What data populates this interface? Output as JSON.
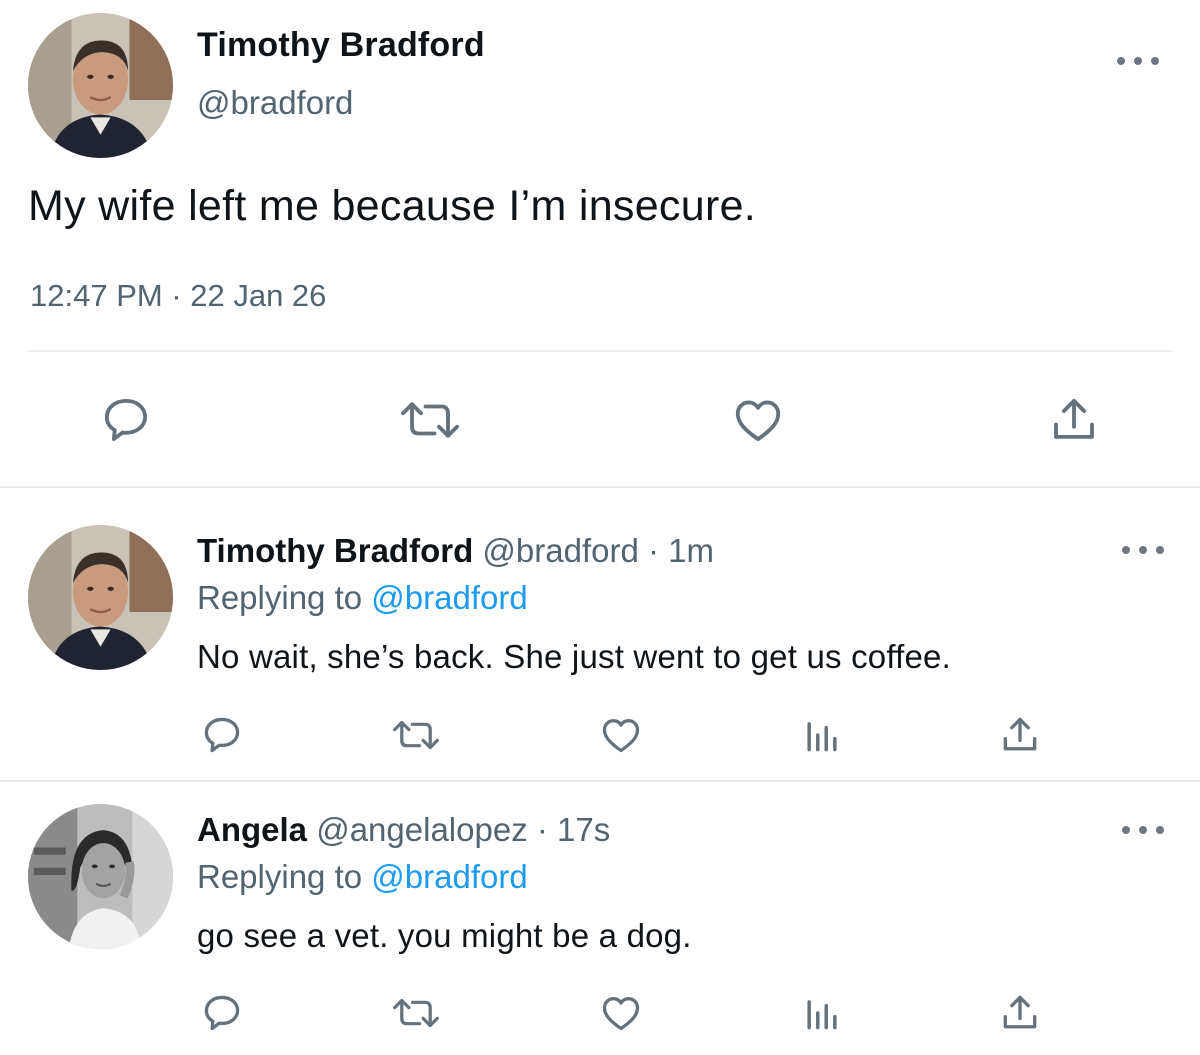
{
  "main_tweet": {
    "author_name": "Timothy Bradford",
    "author_handle": "@bradford",
    "text": "My wife left me because I’m insecure.",
    "timestamp": "12:47 PM · 22 Jan 26",
    "actions": [
      "reply-icon",
      "retweet-icon",
      "like-icon",
      "share-icon"
    ]
  },
  "replies": [
    {
      "author_name": "Timothy Bradford",
      "author_handle": "@bradford",
      "separator": "·",
      "time_ago": "1m",
      "replying_prefix": "Replying to",
      "replying_to": "@bradford",
      "text": "No wait, she’s back. She just went to get us coffee.",
      "actions": [
        "reply-icon",
        "retweet-icon",
        "like-icon",
        "analytics-icon",
        "share-icon"
      ]
    },
    {
      "author_name": "Angela",
      "author_handle": "@angelalopez",
      "separator": "·",
      "time_ago": "17s",
      "replying_prefix": "Replying to",
      "replying_to": "@bradford",
      "text": "go see a vet. you might be a dog.",
      "actions": [
        "reply-icon",
        "retweet-icon",
        "like-icon",
        "analytics-icon",
        "share-icon"
      ]
    }
  ],
  "colors": {
    "text": "#0f1419",
    "secondary": "#536471",
    "link": "#1d9bf0",
    "icon": "#65727c",
    "divider": "#e6e9eb"
  }
}
